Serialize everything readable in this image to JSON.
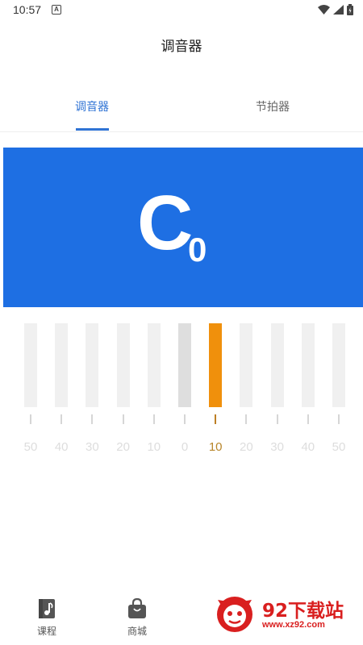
{
  "status_bar": {
    "time": "10:57",
    "notification_icon": "a-letter-icon",
    "icons": [
      "wifi-icon",
      "signal-icon",
      "battery-icon"
    ]
  },
  "app": {
    "title": "调音器"
  },
  "tabs": [
    {
      "label": "调音器",
      "active": true
    },
    {
      "label": "节拍器",
      "active": false
    }
  ],
  "tuner": {
    "note": "C",
    "octave": "0",
    "scale": [
      "50",
      "40",
      "30",
      "20",
      "10",
      "0",
      "10",
      "20",
      "30",
      "40",
      "50"
    ],
    "active_index": 6,
    "accent_color": "#1e6fe3",
    "indicator_color": "#f0900c"
  },
  "bottom_nav": [
    {
      "label": "课程",
      "icon": "music-book-icon"
    },
    {
      "label": "商城",
      "icon": "shopping-bag-icon"
    }
  ],
  "watermark": {
    "brand": "92下载站",
    "url": "www.xz92.com"
  }
}
